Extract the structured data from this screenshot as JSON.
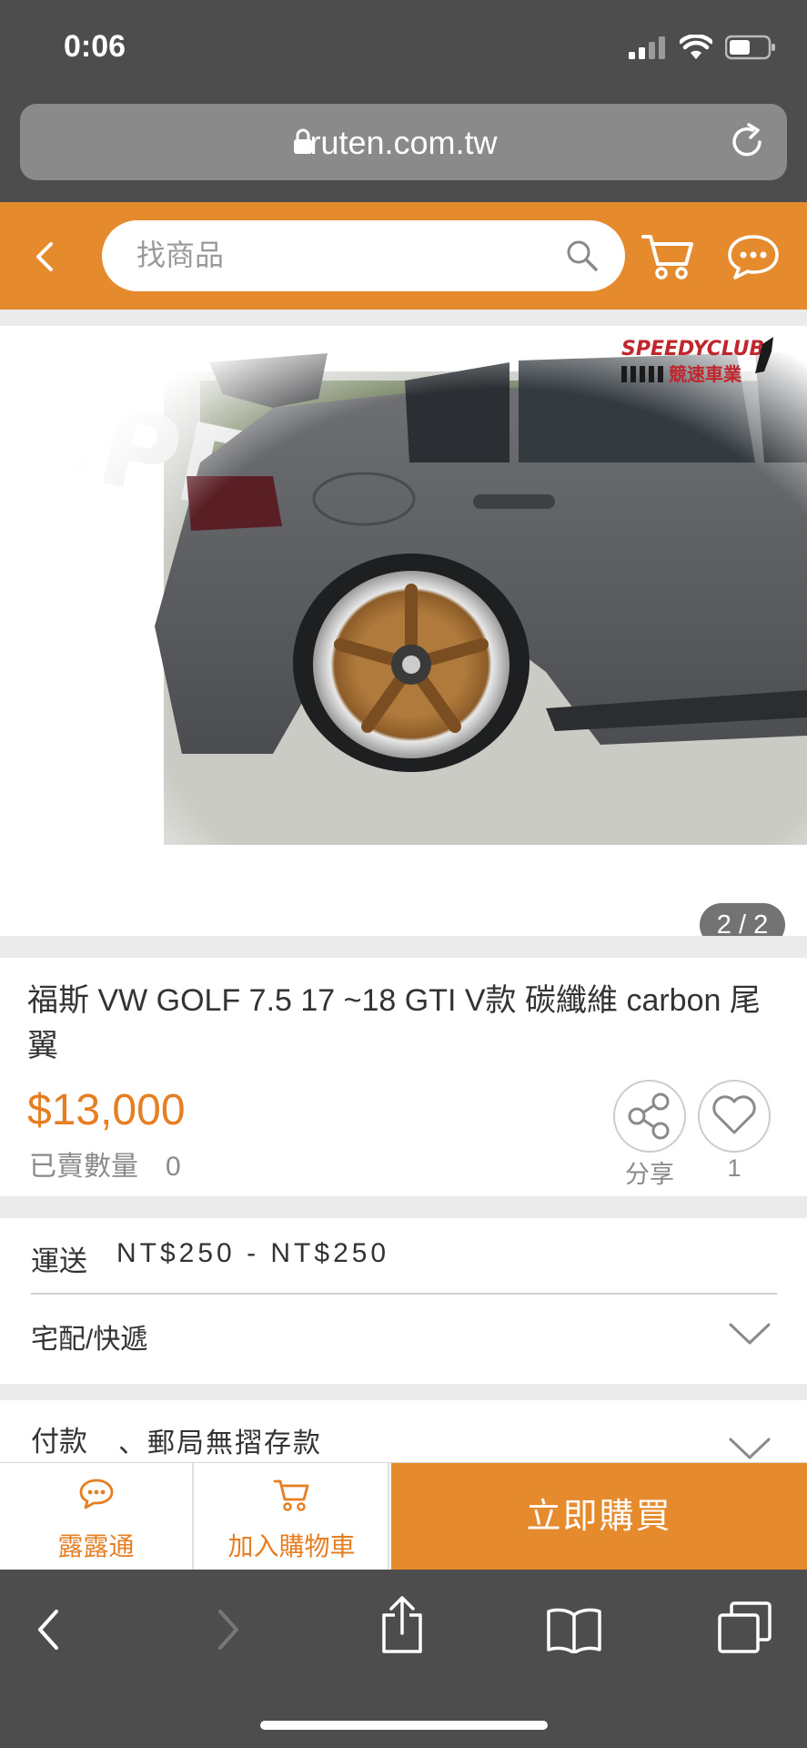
{
  "status_bar": {
    "time": "0:06"
  },
  "browser": {
    "url": "ruten.com.tw"
  },
  "header": {
    "search_placeholder": "找商品"
  },
  "product": {
    "image_counter": "2 / 2",
    "watermark_brand": "SPEEDYCLUB",
    "watermark_text": "競速車業",
    "title": "福斯 VW GOLF 7.5 17 ~18 GTI V款 碳纖維 carbon 尾翼",
    "price": "$13,000",
    "sold_label": "已賣數量",
    "sold_count": "0",
    "sold_text": "已賣數量　0",
    "share_label": "分享",
    "favorite_count": "1"
  },
  "shipping": {
    "label": "運送",
    "price_range": "NT$250 - NT$250",
    "method": "宅配/快遞"
  },
  "payment": {
    "label": "付款",
    "methods": "、郵局無摺存款"
  },
  "actions": {
    "chat_label": "露露通",
    "add_to_cart_label": "加入購物車",
    "buy_now_label": "立即購買"
  },
  "colors": {
    "brand_orange": "#e68a2e",
    "price_orange": "#e67e22",
    "chrome_gray": "#4d4d4d"
  },
  "icons": [
    "lock-icon",
    "reload-icon",
    "back-icon",
    "search-icon",
    "cart-icon",
    "chat-icon",
    "share-icon",
    "heart-icon",
    "chevron-down-icon",
    "forward-icon",
    "share-sheet-icon",
    "bookmarks-icon",
    "tabs-icon"
  ]
}
